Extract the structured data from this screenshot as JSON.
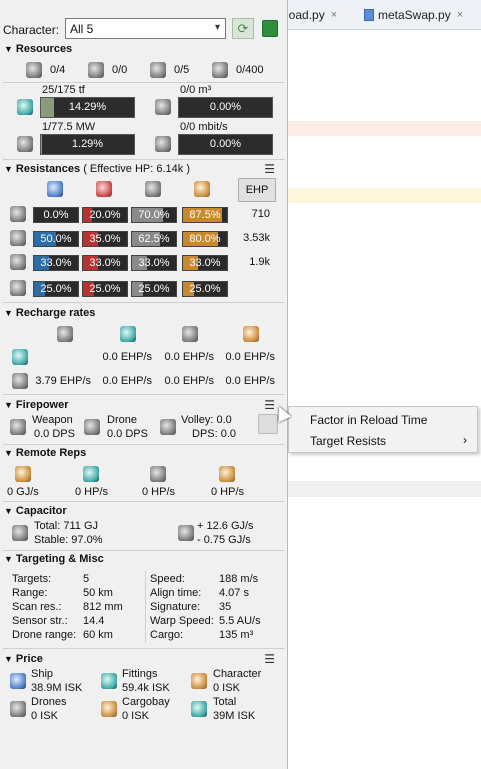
{
  "ide": {
    "tabs": [
      {
        "label": "load.py",
        "close": "×"
      },
      {
        "label": "metaSwap.py",
        "close": "×"
      }
    ]
  },
  "character": {
    "label": "Character:",
    "selected": "All 5",
    "dropdown_icon": "chevron-down-icon"
  },
  "resources": {
    "title": "Resources",
    "counts": [
      {
        "icon": "turret-hardpoint-icon",
        "value": "0/4"
      },
      {
        "icon": "launcher-hardpoint-icon",
        "value": "0/0"
      },
      {
        "icon": "drone-bay-icon",
        "value": "0/5"
      },
      {
        "icon": "fighter-icon",
        "value": "0/400"
      }
    ],
    "cpu": {
      "top": "25/175 tf",
      "percent": "14.29%",
      "fill": 0.1429
    },
    "drone_capacity": {
      "top": "0/0 m³",
      "percent": "0.00%",
      "fill": 0
    },
    "power": {
      "top": "1/77.5 MW",
      "percent": "1.29%",
      "fill": 0.0129
    },
    "bandwidth": {
      "top": "0/0 mbit/s",
      "percent": "0.00%",
      "fill": 0
    }
  },
  "resistances": {
    "title": "Resistances",
    "subtitle": "( Effective HP: 6.14k )",
    "ehp_button": "EHP",
    "rows": [
      {
        "layer": "shield",
        "values": [
          "0.0%",
          "20.0%",
          "70.0%",
          "87.5%"
        ],
        "fills": [
          0,
          0.2,
          0.7,
          0.875
        ],
        "ehp": "710"
      },
      {
        "layer": "armor",
        "values": [
          "50.0%",
          "35.0%",
          "62.5%",
          "80.0%"
        ],
        "fills": [
          0.5,
          0.35,
          0.625,
          0.8
        ],
        "ehp": "3.53k"
      },
      {
        "layer": "hull",
        "values": [
          "33.0%",
          "33.0%",
          "33.0%",
          "33.0%"
        ],
        "fills": [
          0.33,
          0.33,
          0.33,
          0.33
        ],
        "ehp": "1.9k"
      },
      {
        "layer": "damage-pattern",
        "values": [
          "25.0%",
          "25.0%",
          "25.0%",
          "25.0%"
        ],
        "fills": [
          0.25,
          0.25,
          0.25,
          0.25
        ],
        "ehp": ""
      }
    ],
    "colors": {
      "em": "#2e6da4",
      "thermal": "#b83232",
      "kinetic": "#8a8a8a",
      "explosive": "#c8892e"
    }
  },
  "recharge": {
    "title": "Recharge rates",
    "row1": [
      "",
      "0.0 EHP/s",
      "0.0 EHP/s",
      "0.0 EHP/s"
    ],
    "row2": [
      "3.79 EHP/s",
      "0.0 EHP/s",
      "0.0 EHP/s",
      "0.0 EHP/s"
    ]
  },
  "firepower": {
    "title": "Firepower",
    "weapon_label": "Weapon",
    "weapon_dps": "0.0 DPS",
    "drone_label": "Drone",
    "drone_dps": "0.0 DPS",
    "volley": "Volley: 0.0",
    "dps": "DPS: 0.0"
  },
  "remote_reps": {
    "title": "Remote Reps",
    "values": [
      "0 GJ/s",
      "0 HP/s",
      "0 HP/s",
      "0 HP/s"
    ]
  },
  "capacitor": {
    "title": "Capacitor",
    "total": "Total: 711 GJ",
    "stable": "Stable: 97.0%",
    "plus": "+ 12.6 GJ/s",
    "minus": "- 0.75 GJ/s"
  },
  "targeting": {
    "title": "Targeting & Misc",
    "left": [
      {
        "label": "Targets:",
        "value": "5"
      },
      {
        "label": "Range:",
        "value": "50 km"
      },
      {
        "label": "Scan res.:",
        "value": "812 mm"
      },
      {
        "label": "Sensor str.:",
        "value": "14.4"
      },
      {
        "label": "Drone range:",
        "value": "60 km"
      }
    ],
    "right": [
      {
        "label": "Speed:",
        "value": "188 m/s"
      },
      {
        "label": "Align time:",
        "value": "4.07 s"
      },
      {
        "label": "Signature:",
        "value": "35"
      },
      {
        "label": "Warp Speed:",
        "value": "5.5 AU/s"
      },
      {
        "label": "Cargo:",
        "value": "135 m³"
      }
    ]
  },
  "price": {
    "title": "Price",
    "items": [
      {
        "label": "Ship",
        "value": "38.9M ISK"
      },
      {
        "label": "Fittings",
        "value": "59.4k ISK"
      },
      {
        "label": "Character",
        "value": "0 ISK"
      },
      {
        "label": "Drones",
        "value": "0 ISK"
      },
      {
        "label": "Cargobay",
        "value": "0 ISK"
      },
      {
        "label": "Total",
        "value": "39M ISK"
      }
    ]
  },
  "context_menu": {
    "items": [
      "Factor in Reload Time",
      "Target Resists"
    ],
    "submenu_arrow": "›"
  }
}
